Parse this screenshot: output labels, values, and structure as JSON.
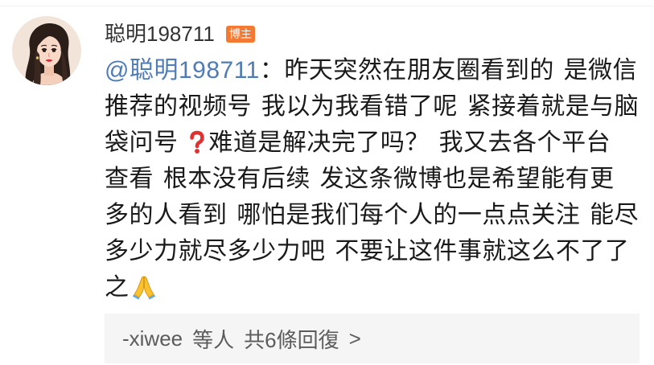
{
  "comment_card": {
    "author": {
      "name": "聪明198711",
      "badge": "博主",
      "avatar_icon": "avatar-icon"
    },
    "comment": {
      "mention": "@聪明198711",
      "lines": [
        "：昨天突然在朋友圈看到的 是微信",
        "推荐的视频号 我以为我看错了呢 紧接着就是与脑",
        {
          "before_icon": "袋问号 ",
          "after_icon": "难道是解决完了吗？ 我又去各个平台"
        },
        "查看 根本没有后续 发这条微博也是希望能有更",
        "多的人看到 哪怕是我们每个人的一点点关注 能尽",
        "多少力就尽多少力吧 不要让这件事就这么不了了",
        "之"
      ],
      "icons": {
        "line_3": "red-question-mark-icon",
        "line_7": "praying-hands-icon"
      }
    },
    "replies": {
      "users": "-xiwee",
      "suffix": "等人",
      "count_label": "共6條回復",
      "chevron": ">"
    }
  },
  "colors": {
    "author": "#333333",
    "badge": "#f37a33",
    "text": "#1a1a1a",
    "mention": "#4f7cb5",
    "reply_bg": "#f5f5f5",
    "reply_text": "#5c5c5c",
    "question_mark": "#e0302f",
    "pray": "#f9c22e"
  }
}
